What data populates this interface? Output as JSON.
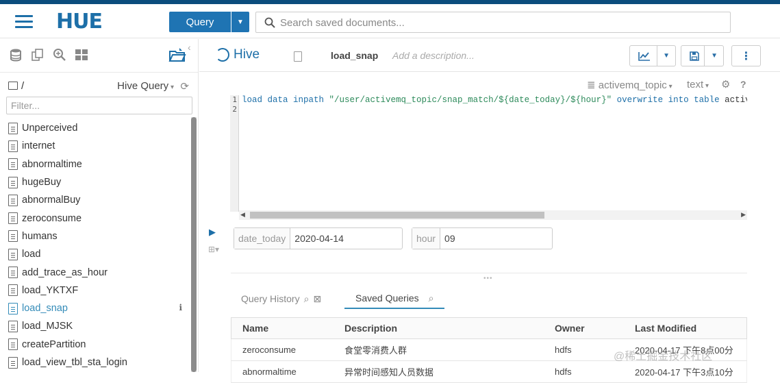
{
  "header": {
    "logo_text": "HUE",
    "query_button_label": "Query",
    "search_placeholder": "Search saved documents..."
  },
  "left_panel": {
    "path": "/",
    "query_type": "Hive Query",
    "filter_placeholder": "Filter...",
    "documents": [
      {
        "name": "Unperceived"
      },
      {
        "name": "internet"
      },
      {
        "name": "abnormaltime"
      },
      {
        "name": "hugeBuy"
      },
      {
        "name": "abnormalBuy"
      },
      {
        "name": "zeroconsume"
      },
      {
        "name": "humans"
      },
      {
        "name": "load"
      },
      {
        "name": "add_trace_as_hour"
      },
      {
        "name": "load_YKTXF"
      },
      {
        "name": "load_snap"
      },
      {
        "name": "load_MJSK"
      },
      {
        "name": "createPartition"
      },
      {
        "name": "load_view_tbl_sta_login"
      }
    ],
    "active_document": "load_snap"
  },
  "editor": {
    "engine": "Hive",
    "doc_name": "load_snap",
    "description_placeholder": "Add a description...",
    "database": "activemq_topic",
    "format": "text",
    "line_numbers": [
      "1",
      "2"
    ],
    "code": {
      "kw1": "load data inpath ",
      "str1": "\"/user/activemq_topic/snap_match/${date_today}/${hour}\"",
      "kw2": " overwrite into table ",
      "rest": "activemq_topic.snap_match"
    },
    "params": [
      {
        "name": "date_today",
        "value": "2020-04-14"
      },
      {
        "name": "hour",
        "value": "09"
      }
    ]
  },
  "results": {
    "tabs": [
      {
        "label": "Query History"
      },
      {
        "label": "Saved Queries"
      }
    ],
    "active_tab": "Saved Queries",
    "columns": [
      "Name",
      "Description",
      "Owner",
      "Last Modified"
    ],
    "rows": [
      {
        "name": "zeroconsume",
        "description": "食堂零消费人群",
        "owner": "hdfs",
        "modified": "2020-04-17 下午8点00分"
      },
      {
        "name": "abnormaltime",
        "description": "异常时间感知人员数据",
        "owner": "hdfs",
        "modified": "2020-04-17 下午3点10分"
      }
    ]
  },
  "watermark": "@稀土掘金技术社区",
  "colors": {
    "brand": "#1d6fa8",
    "primary_button": "#1f74b3",
    "active_link": "#338bb8"
  }
}
